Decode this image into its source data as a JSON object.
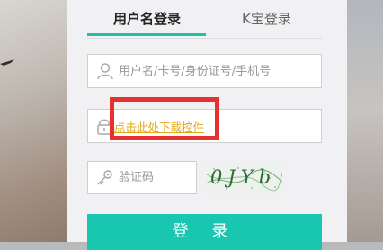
{
  "tabs": [
    {
      "label": "用户名登录",
      "active": true
    },
    {
      "label": "K宝登录",
      "active": false
    }
  ],
  "username": {
    "placeholder": "用户名/卡号/身份证号/手机号",
    "value": "",
    "icon": "user-icon"
  },
  "password": {
    "download_link": "点击此处下载控件",
    "icon": "lock-icon"
  },
  "captcha": {
    "placeholder": "验证码",
    "value": "",
    "icon": "key-icon",
    "image_text": "0JYb"
  },
  "login_button": "登 录",
  "colors": {
    "accent": "#19c7b0",
    "link": "#e3a717",
    "highlight": "#e8312f"
  }
}
